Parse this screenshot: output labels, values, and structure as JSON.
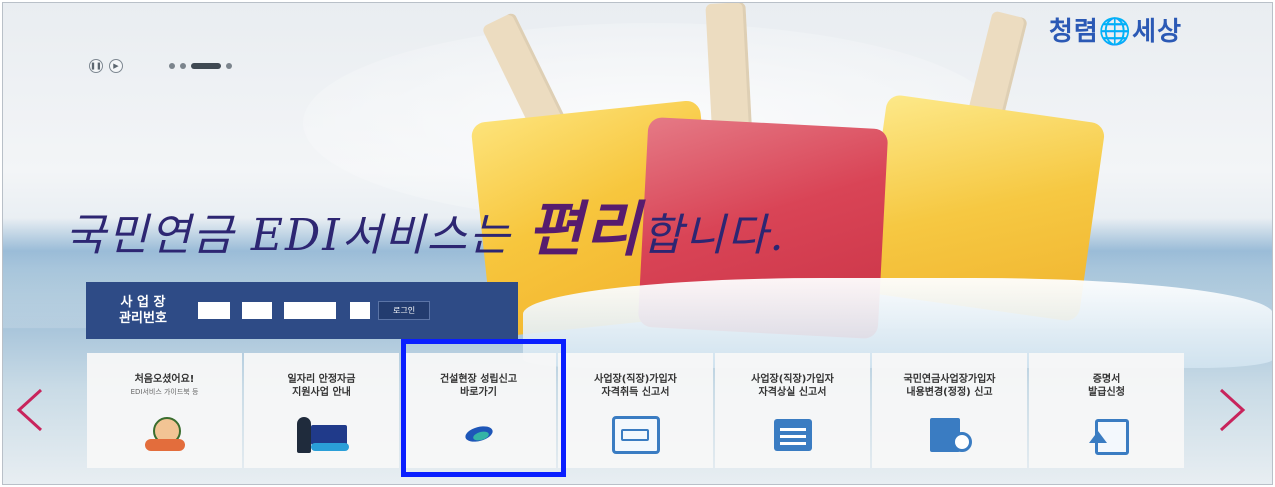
{
  "banner": {
    "logo": "청렴🌐세상",
    "headline_pre": "국민연금 EDI서비스는 ",
    "headline_emph": "편리",
    "headline_post": "합니다."
  },
  "slider": {
    "pause_icon": "pause-icon",
    "play_icon": "play-icon",
    "dot_count": 4,
    "active_dot": 3
  },
  "login": {
    "label_line1": "사 업 장",
    "label_line2": "관리번호",
    "button_label": "로그인"
  },
  "tiles": [
    {
      "line1": "처음오셨어요!",
      "sub": "EDI서비스 가이드북 등",
      "icon": "mascot-icon"
    },
    {
      "line1": "일자리 안정자금",
      "line2": "지원사업 안내",
      "icon": "job-support-icon"
    },
    {
      "line1": "건설현장 성립신고",
      "line2": "바로가기",
      "icon": "nps-logo-icon"
    },
    {
      "line1": "사업장(직장)가입자",
      "line2": "자격취득 신고서",
      "icon": "id-card-icon"
    },
    {
      "line1": "사업장(직장)가입자",
      "line2": "자격상실 신고서",
      "icon": "calendar-icon"
    },
    {
      "line1": "국민연금사업장가입자",
      "line2": "내용변경(정정) 신고",
      "icon": "document-search-icon"
    },
    {
      "line1": "증명서",
      "line2": "발급신청",
      "icon": "certificate-icon"
    }
  ],
  "nav": {
    "prev_icon": "chevron-left-icon",
    "next_icon": "chevron-right-icon"
  },
  "colors": {
    "panel": "#2e4b86",
    "headline": "#2d2672",
    "emphasis": "#571c6e",
    "highlight": "#0a1fff",
    "arrow": "#c8245c"
  }
}
